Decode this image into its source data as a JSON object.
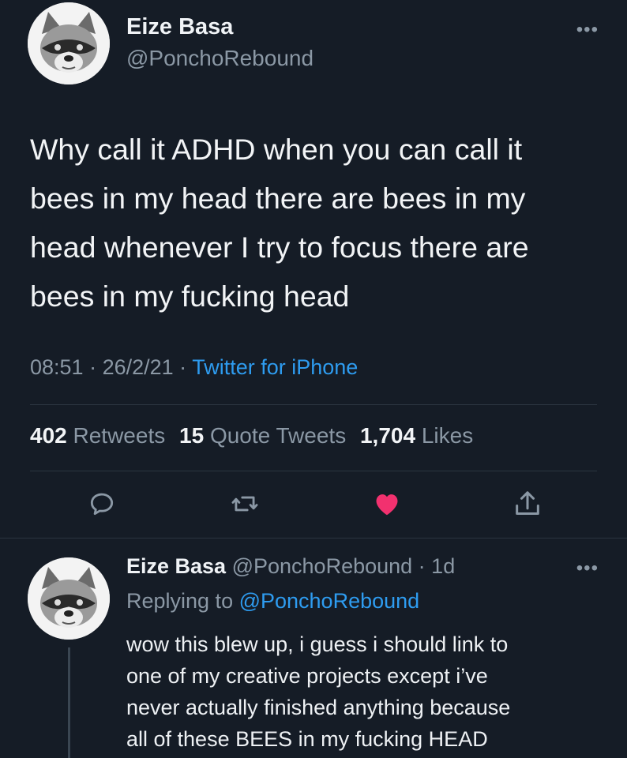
{
  "tweet": {
    "author_name": "Eize Basa",
    "author_handle": "@PonchoRebound",
    "more_label": "•••",
    "text": "Why call it ADHD when you can call it\nbees in my head there are bees in my\nhead whenever I try to focus there are\nbees in my fucking head",
    "time": "08:51",
    "date": "26/2/21",
    "separator": " · ",
    "source": "Twitter for iPhone",
    "stats": {
      "retweets_count": "402",
      "retweets_label": "Retweets",
      "quotes_count": "15",
      "quotes_label": "Quote Tweets",
      "likes_count": "1,704",
      "likes_label": "Likes"
    },
    "actions": [
      "reply-icon",
      "retweet-icon",
      "like-icon",
      "share-icon"
    ],
    "liked": true
  },
  "reply": {
    "author_name": "Eize Basa",
    "author_handle": "@PonchoRebound",
    "age": "1d",
    "separator": " · ",
    "more_label": "•••",
    "replying_prefix": "Replying to ",
    "replying_to": "@PonchoRebound",
    "text": "wow this blew up, i guess i should link to\none of my creative projects except i’ve\nnever actually finished anything because\nall of these BEES in my fucking HEAD"
  },
  "colors": {
    "background": "#151c26",
    "text_primary": "#f2f4f6",
    "text_secondary": "#8b98a5",
    "link": "#2e9cf0",
    "like": "#f2316f",
    "divider": "#2b3540"
  }
}
